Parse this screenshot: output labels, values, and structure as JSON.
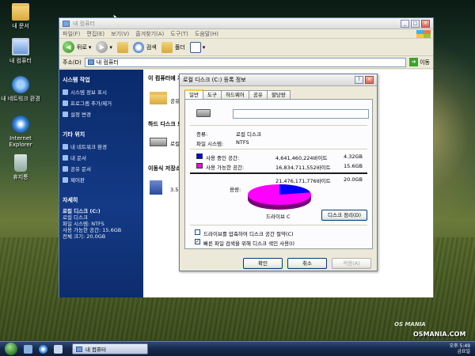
{
  "desktop": {
    "icons": [
      {
        "label": "내 문서",
        "icon": "folder-icon"
      },
      {
        "label": "내 컴퓨터",
        "icon": "computer-icon"
      },
      {
        "label": "내 네트워크 환경",
        "icon": "network-icon"
      },
      {
        "label": "Internet Explorer",
        "icon": "ie-icon"
      },
      {
        "label": "휴지통",
        "icon": "recycle-bin-icon"
      }
    ]
  },
  "explorer": {
    "title": "내 컴퓨터",
    "menu": [
      "파일(F)",
      "편집(E)",
      "보기(V)",
      "즐겨찾기(A)",
      "도구(T)",
      "도움말(H)"
    ],
    "toolbar": {
      "back": "뒤로",
      "search": "검색",
      "folders": "폴더"
    },
    "address_label": "주소(D)",
    "address_value": "내 컴퓨터",
    "go_label": "이동",
    "sidebar": {
      "system_tasks_title": "시스템 작업",
      "system_tasks": [
        "시스템 정보 표시",
        "프로그램 추가/제거",
        "설정 변경"
      ],
      "other_places_title": "기타 위치",
      "other_places": [
        "내 네트워크 환경",
        "내 문서",
        "공유 문서",
        "제어판"
      ],
      "details_title": "자세히",
      "details": [
        "로컬 디스크 (C:)",
        "로컬 디스크",
        "파일 시스템: NTFS",
        "사용 가능한 공간: 15.6GB",
        "전체 크기: 20.0GB"
      ]
    },
    "content": {
      "groups": [
        "이 컴퓨터에 저장된 파일",
        "하드 디스크 드라이브",
        "이동식 저장소가 있는 장치"
      ],
      "folder_label": "공유",
      "hdd_label": "로컬",
      "floppy_label": "3.5"
    }
  },
  "dialog": {
    "title": "로컬 디스크 (C:) 등록 정보",
    "tabs": [
      "일반",
      "도구",
      "하드웨어",
      "공유",
      "할당량"
    ],
    "name_value": "",
    "type_label": "종류:",
    "type_value": "로컬 디스크",
    "fs_label": "파일 시스템:",
    "fs_value": "NTFS",
    "used_label": "사용 중인 공간:",
    "used_bytes": "4,641,460,224바이트",
    "used_gb": "4.32GB",
    "free_label": "사용 가능한 공간:",
    "free_bytes": "16,834,711,552바이트",
    "free_gb": "15.6GB",
    "capacity_label": "용량:",
    "capacity_bytes": "21,476,171,776바이트",
    "capacity_gb": "20.0GB",
    "drive_label": "드라이브 C",
    "cleanup_button": "디스크 정리(D)",
    "compress_label": "드라이브를 압축하여 디스크 공간 절약(C)",
    "compress_checked": false,
    "index_label": "빠른 파일 검색을 위해 디스크 색인 사용(I)",
    "index_checked": true,
    "ok_button": "확인",
    "cancel_button": "취소",
    "apply_button": "적용(A)",
    "used_fraction": 0.216,
    "colors": {
      "used": "#0000ff",
      "free": "#ff00ff"
    }
  },
  "taskbar": {
    "task_label": "내 컴퓨터",
    "time": "오후 5:49",
    "day": "금요일"
  },
  "watermark": {
    "line1": "OS MANIA",
    "line2": "OSMANIA.COM"
  }
}
